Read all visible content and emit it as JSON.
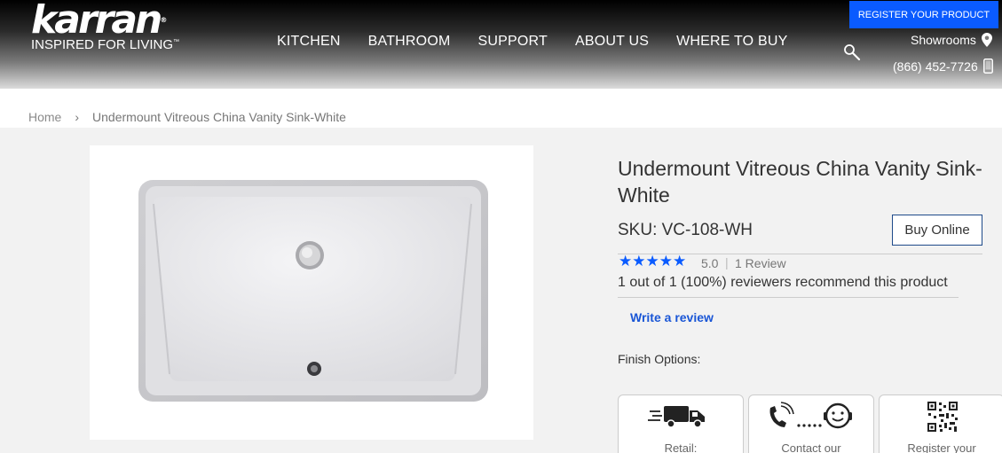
{
  "brand": {
    "name": "karran",
    "registered_mark": "®",
    "tagline": "INSPIRED FOR LIVING",
    "tagline_mark": "™"
  },
  "nav": {
    "items": [
      "KITCHEN",
      "BATHROOM",
      "SUPPORT",
      "ABOUT US",
      "WHERE TO BUY"
    ]
  },
  "header": {
    "register_label": "REGISTER YOUR PRODUCT",
    "showrooms_label": "Showrooms",
    "phone": "(866) 452-7726"
  },
  "breadcrumb": {
    "home": "Home",
    "separator": "›",
    "current": "Undermount Vitreous China Vanity Sink-White"
  },
  "product": {
    "title": "Undermount Vitreous China Vanity Sink-White",
    "sku": "SKU: VC-108-WH",
    "buy_label": "Buy Online",
    "rating": "5.0",
    "rating_separator": "|",
    "review_count": "1 Review",
    "stars": "★★★★★",
    "recommend_text": "1 out of 1 (100%) reviewers recommend this product",
    "write_review": "Write a review",
    "finish_label": "Finish Options:"
  },
  "cards": [
    {
      "label": "Retail:",
      "icon": "delivery-truck-icon"
    },
    {
      "label": "Contact our",
      "icon": "customer-support-icon"
    },
    {
      "label": "Register your",
      "icon": "qr-code-icon"
    }
  ],
  "colors": {
    "accent_blue": "#0a5bff",
    "star_blue": "#0a5bff",
    "link_blue": "#1a56d6"
  }
}
